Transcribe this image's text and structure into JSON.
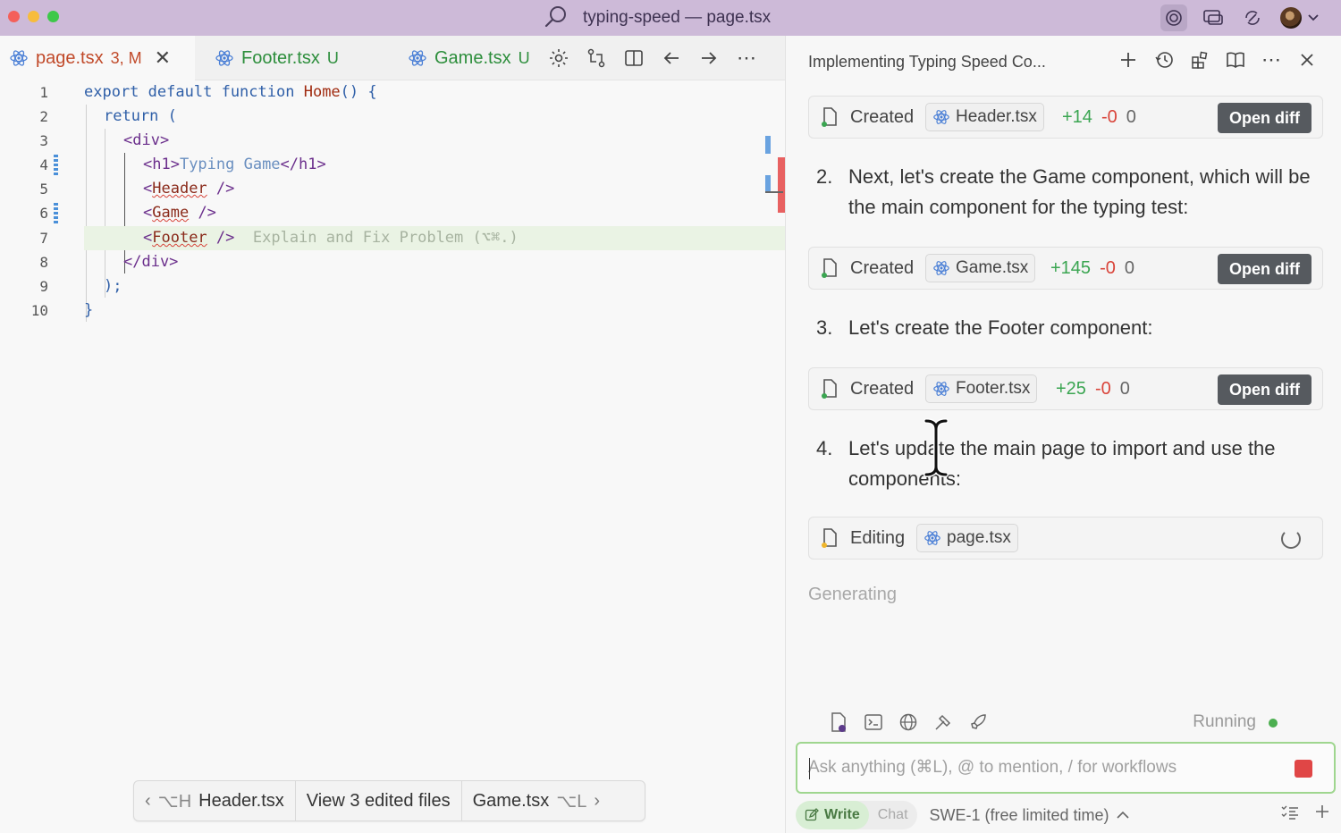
{
  "window": {
    "title": "typing-speed — page.tsx"
  },
  "tabs": [
    {
      "label": "page.tsx",
      "badge": "3, M",
      "status": "modified",
      "active": true
    },
    {
      "label": "Footer.tsx",
      "badge": "U",
      "status": "untracked",
      "active": false
    },
    {
      "label": "Game.tsx",
      "badge": "U",
      "status": "untracked",
      "active": false
    }
  ],
  "editor": {
    "lines": [
      {
        "n": "1"
      },
      {
        "n": "2"
      },
      {
        "n": "3"
      },
      {
        "n": "4"
      },
      {
        "n": "5"
      },
      {
        "n": "6"
      },
      {
        "n": "7"
      },
      {
        "n": "8"
      },
      {
        "n": "9"
      },
      {
        "n": "10"
      }
    ],
    "code": {
      "l1_export": "export",
      "l1_default": "default",
      "l1_function": "function",
      "l1_name": "Home",
      "l1_rest": "() {",
      "l2_return": "return",
      "l2_paren": "(",
      "l3_div": "<div>",
      "l4_open": "<h1>",
      "l4_text": "Typing Game",
      "l4_close": "</h1>",
      "l5_lt": "<",
      "l5_tag": "Header",
      "l5_end": " />",
      "l6_lt": "<",
      "l6_tag": "Game",
      "l6_end": " />",
      "l7_lt": "<",
      "l7_tag": "Footer",
      "l7_end": " />",
      "l7_hint": "Explain and Fix Problem (⌥⌘.)",
      "l8_div": "</div>",
      "l9": ");",
      "l10": "}"
    }
  },
  "file_nav": {
    "prev_key": "⌥H",
    "prev_file": "Header.tsx",
    "center": "View 3 edited files",
    "next_file": "Game.tsx",
    "next_key": "⌥L"
  },
  "panel": {
    "title": "Implementing Typing Speed Co...",
    "cards": [
      {
        "label": "Created",
        "file": "Header.tsx",
        "added": "+14",
        "removed": "-0",
        "other": "0",
        "action": "Open diff"
      },
      {
        "label": "Created",
        "file": "Game.tsx",
        "added": "+145",
        "removed": "-0",
        "other": "0",
        "action": "Open diff"
      },
      {
        "label": "Created",
        "file": "Footer.tsx",
        "added": "+25",
        "removed": "-0",
        "other": "0",
        "action": "Open diff"
      },
      {
        "label": "Editing",
        "file": "page.tsx"
      }
    ],
    "steps": [
      {
        "num": "2.",
        "text": "Next, let's create the Game component, which will be the main component for the typing test:"
      },
      {
        "num": "3.",
        "text": "Let's create the Footer component:"
      },
      {
        "num": "4.",
        "text": "Let's update the main page to import and use the components:"
      }
    ],
    "generating": "Generating",
    "running": "Running",
    "ask_placeholder": "Ask anything (⌘L), @ to mention, / for workflows",
    "mode_write": "Write",
    "mode_chat": "Chat",
    "model": "SWE-1 (free limited time)"
  },
  "colors": {
    "titlebar": "#cdbad8",
    "accent_green": "#3aa551",
    "accent_red": "#d9443a",
    "open_diff_bg": "#565a5f"
  }
}
